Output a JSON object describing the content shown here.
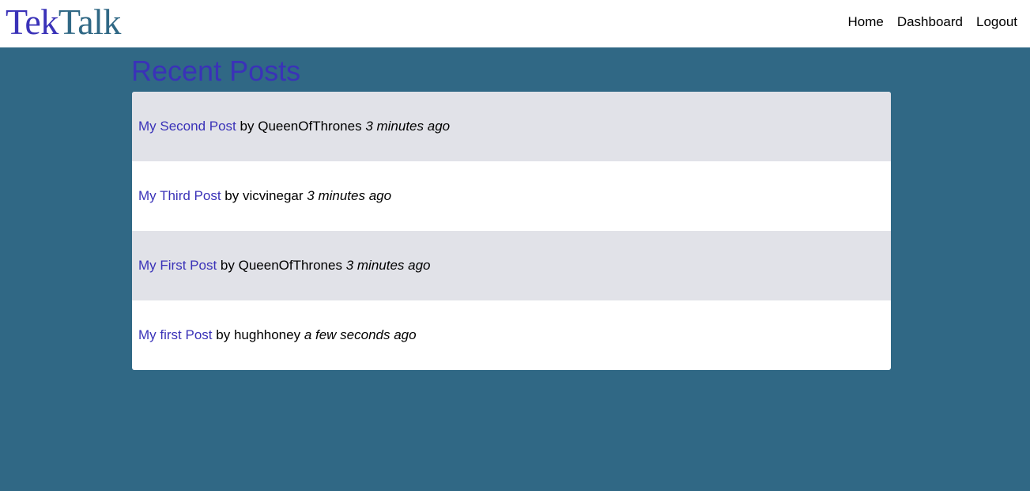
{
  "brand": {
    "part1": "Tek",
    "part2": "Talk"
  },
  "nav": {
    "home": "Home",
    "dashboard": "Dashboard",
    "logout": "Logout"
  },
  "main": {
    "title": "Recent Posts",
    "posts": [
      {
        "title": "My Second Post",
        "by": "by",
        "author": "QueenOfThrones",
        "time": "3 minutes ago"
      },
      {
        "title": "My Third Post",
        "by": "by",
        "author": "vicvinegar",
        "time": "3 minutes ago"
      },
      {
        "title": "My First Post",
        "by": "by",
        "author": "QueenOfThrones",
        "time": "3 minutes ago"
      },
      {
        "title": "My first Post",
        "by": "by",
        "author": "hughhoney",
        "time": "a few seconds ago"
      }
    ]
  },
  "colors": {
    "page_background": "#306885",
    "accent": "#3a32b8",
    "row_alt": "#e1e2e8"
  }
}
